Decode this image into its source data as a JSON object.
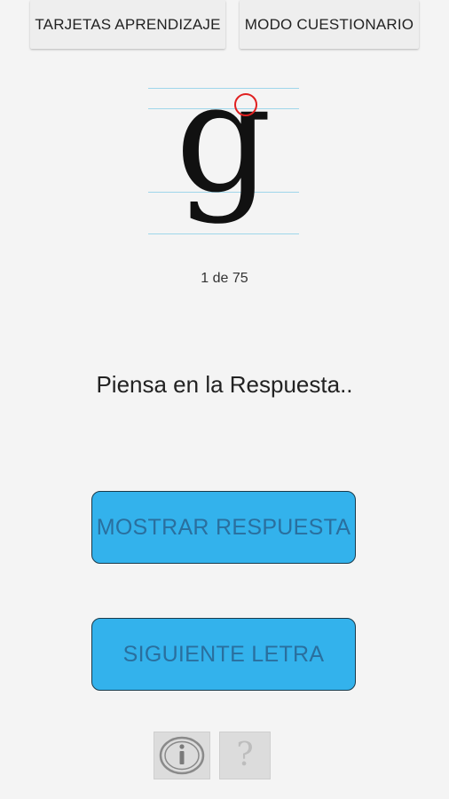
{
  "tabs": {
    "flashcards_label": "TARJETAS APRENDIZAJE",
    "quiz_label": "MODO CUESTIONARIO"
  },
  "card": {
    "letter": "g",
    "counter": "1 de 75",
    "prompt": "Piensa en la Respuesta.."
  },
  "actions": {
    "show_answer_label": "MOSTRAR RESPUESTA",
    "next_letter_label": "SIGUIENTE LETRA"
  },
  "footer": {
    "info_icon": "info-icon",
    "help_icon": "question-mark-icon",
    "help_glyph": "?"
  },
  "colors": {
    "button_fill": "#33b2ec",
    "button_text": "#2a6f9e",
    "guide_line": "#9fd6ea",
    "marker": "#e02020"
  }
}
